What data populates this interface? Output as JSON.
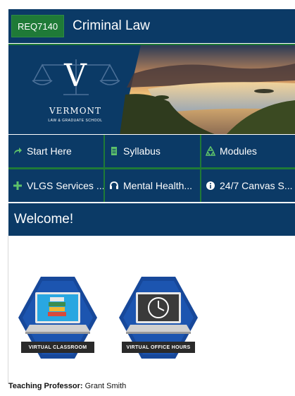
{
  "header": {
    "course_code": "REQ7140",
    "course_title": "Criminal Law"
  },
  "banner": {
    "logo_letter": "V",
    "logo_name": "VERMONT",
    "logo_subtitle": "LAW & GRADUATE SCHOOL"
  },
  "nav": {
    "items": [
      {
        "label": "Start Here",
        "icon": "share-arrow-icon"
      },
      {
        "label": "Syllabus",
        "icon": "document-icon"
      },
      {
        "label": "Modules",
        "icon": "recycle-icon"
      },
      {
        "label": "VLGS Services ...",
        "icon": "plus-icon"
      },
      {
        "label": "Mental Health...",
        "icon": "headset-icon"
      },
      {
        "label": "24/7 Canvas S...",
        "icon": "info-icon"
      }
    ]
  },
  "welcome": {
    "heading": "Welcome!"
  },
  "badges": [
    {
      "label": "VIRTUAL CLASSROOM",
      "icon": "laptop-books-icon"
    },
    {
      "label": "VIRTUAL OFFICE HOURS",
      "icon": "laptop-clock-icon"
    }
  ],
  "professor": {
    "label": "Teaching Professor:",
    "name": " Grant Smith"
  },
  "colors": {
    "navy": "#0b3a66",
    "green": "#1f7a37",
    "hex_blue": "#17489a"
  }
}
